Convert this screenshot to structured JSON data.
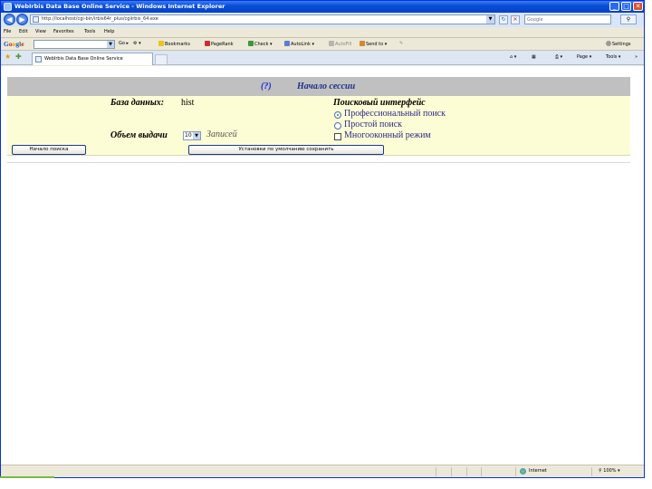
{
  "window": {
    "title": "WebIrbis Data Base Online Service - Windows Internet Explorer",
    "controls": {
      "minimize": "_",
      "maximize": "□",
      "close": "✕"
    }
  },
  "address_bar": {
    "url": "http://localhost/cgi-bin/irbis64r_plus/cgiirbis_64.exe",
    "search_placeholder": "Google"
  },
  "menu": [
    "File",
    "Edit",
    "View",
    "Favorites",
    "Tools",
    "Help"
  ],
  "google_toolbar": {
    "logo": "Google",
    "go_label": "Go",
    "items": [
      "Bookmarks",
      "PageRank",
      "Check",
      "AutoLink",
      "AutoFill",
      "Send to"
    ],
    "settings_label": "Settings"
  },
  "tab": {
    "label": "WebIrbis Data Base Online Service"
  },
  "command_bar": {
    "page_label": "Page",
    "tools_label": "Tools"
  },
  "page": {
    "help_link": "(?)",
    "title": "Начало сессии",
    "database_label": "База данных:",
    "database_value": "hist",
    "search_interface_label": "Поисковый интерфейс",
    "options": [
      {
        "label": "Профессиональный поиск",
        "selected": true
      },
      {
        "label": "Простой поиск",
        "selected": false
      }
    ],
    "multiwindow_label": "Многооконный режим",
    "multiwindow_checked": false,
    "output_volume_label": "Объем выдачи",
    "output_volume_value": "10",
    "records_label": "Записей",
    "start_search_button": "Начало поиска",
    "save_settings_button": "Установки по умолчанию сохранить"
  },
  "status_bar": {
    "zone": "Internet",
    "zoom": "100%"
  },
  "colors": {
    "banner": "#c0c0c0",
    "form_background": "#fdfdd5",
    "title_text": "#1c2f8e"
  }
}
